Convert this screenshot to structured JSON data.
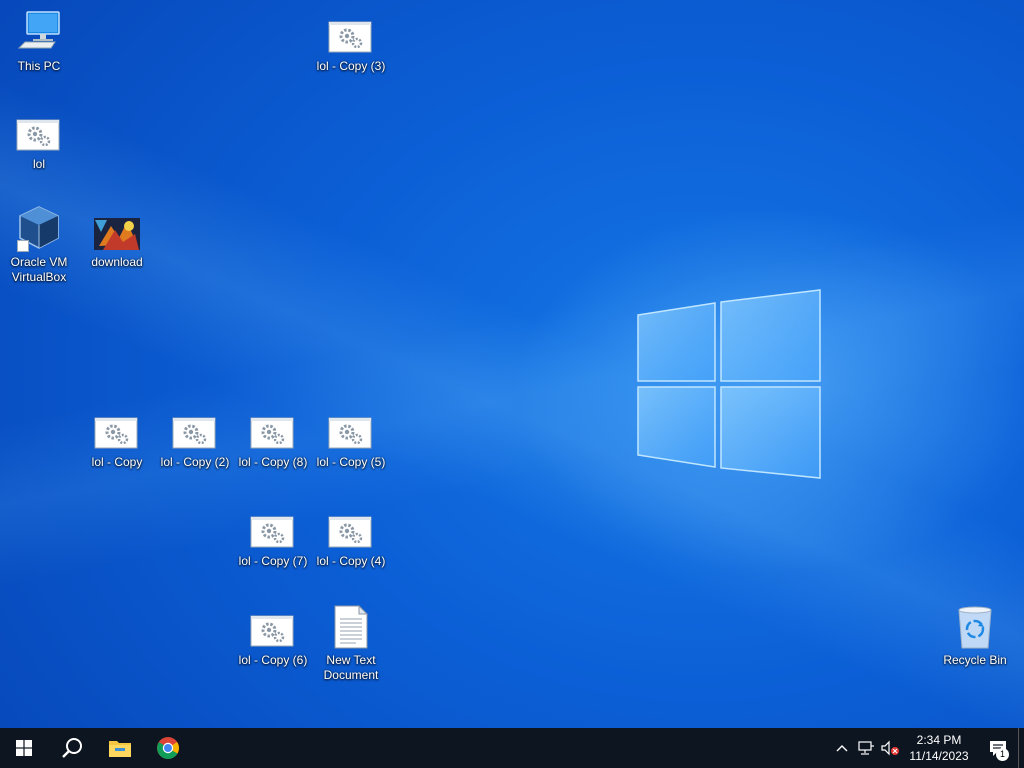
{
  "desktop": {
    "icons": {
      "this_pc": "This PC",
      "lol": "lol",
      "virtualbox": "Oracle VM VirtualBox",
      "download": "download",
      "lol_copy_3": "lol - Copy (3)",
      "lol_copy": "lol - Copy",
      "lol_copy_2": "lol - Copy (2)",
      "lol_copy_8": "lol - Copy (8)",
      "lol_copy_5": "lol - Copy (5)",
      "lol_copy_7": "lol - Copy (7)",
      "lol_copy_4": "lol - Copy (4)",
      "lol_copy_6": "lol - Copy (6)",
      "new_text_document": "New Text Document",
      "recycle_bin": "Recycle Bin"
    }
  },
  "taskbar": {
    "apps": [
      "start-icon",
      "search-icon",
      "file-explorer-icon",
      "chrome-icon"
    ],
    "clock": {
      "time": "2:34 PM",
      "date": "11/14/2023"
    },
    "notifications": {
      "count": "1"
    }
  },
  "colors": {
    "taskbar": "#0d1520",
    "desktop_accent": "#0c5fd6"
  }
}
